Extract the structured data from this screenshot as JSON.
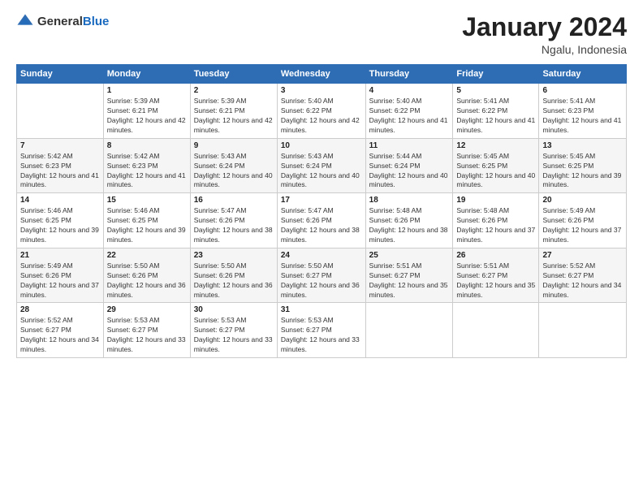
{
  "logo": {
    "text_general": "General",
    "text_blue": "Blue"
  },
  "header": {
    "month": "January 2024",
    "location": "Ngalu, Indonesia"
  },
  "weekdays": [
    "Sunday",
    "Monday",
    "Tuesday",
    "Wednesday",
    "Thursday",
    "Friday",
    "Saturday"
  ],
  "weeks": [
    [
      {
        "day": "",
        "sunrise": "",
        "sunset": "",
        "daylight": ""
      },
      {
        "day": "1",
        "sunrise": "Sunrise: 5:39 AM",
        "sunset": "Sunset: 6:21 PM",
        "daylight": "Daylight: 12 hours and 42 minutes."
      },
      {
        "day": "2",
        "sunrise": "Sunrise: 5:39 AM",
        "sunset": "Sunset: 6:21 PM",
        "daylight": "Daylight: 12 hours and 42 minutes."
      },
      {
        "day": "3",
        "sunrise": "Sunrise: 5:40 AM",
        "sunset": "Sunset: 6:22 PM",
        "daylight": "Daylight: 12 hours and 42 minutes."
      },
      {
        "day": "4",
        "sunrise": "Sunrise: 5:40 AM",
        "sunset": "Sunset: 6:22 PM",
        "daylight": "Daylight: 12 hours and 41 minutes."
      },
      {
        "day": "5",
        "sunrise": "Sunrise: 5:41 AM",
        "sunset": "Sunset: 6:22 PM",
        "daylight": "Daylight: 12 hours and 41 minutes."
      },
      {
        "day": "6",
        "sunrise": "Sunrise: 5:41 AM",
        "sunset": "Sunset: 6:23 PM",
        "daylight": "Daylight: 12 hours and 41 minutes."
      }
    ],
    [
      {
        "day": "7",
        "sunrise": "Sunrise: 5:42 AM",
        "sunset": "Sunset: 6:23 PM",
        "daylight": "Daylight: 12 hours and 41 minutes."
      },
      {
        "day": "8",
        "sunrise": "Sunrise: 5:42 AM",
        "sunset": "Sunset: 6:23 PM",
        "daylight": "Daylight: 12 hours and 41 minutes."
      },
      {
        "day": "9",
        "sunrise": "Sunrise: 5:43 AM",
        "sunset": "Sunset: 6:24 PM",
        "daylight": "Daylight: 12 hours and 40 minutes."
      },
      {
        "day": "10",
        "sunrise": "Sunrise: 5:43 AM",
        "sunset": "Sunset: 6:24 PM",
        "daylight": "Daylight: 12 hours and 40 minutes."
      },
      {
        "day": "11",
        "sunrise": "Sunrise: 5:44 AM",
        "sunset": "Sunset: 6:24 PM",
        "daylight": "Daylight: 12 hours and 40 minutes."
      },
      {
        "day": "12",
        "sunrise": "Sunrise: 5:45 AM",
        "sunset": "Sunset: 6:25 PM",
        "daylight": "Daylight: 12 hours and 40 minutes."
      },
      {
        "day": "13",
        "sunrise": "Sunrise: 5:45 AM",
        "sunset": "Sunset: 6:25 PM",
        "daylight": "Daylight: 12 hours and 39 minutes."
      }
    ],
    [
      {
        "day": "14",
        "sunrise": "Sunrise: 5:46 AM",
        "sunset": "Sunset: 6:25 PM",
        "daylight": "Daylight: 12 hours and 39 minutes."
      },
      {
        "day": "15",
        "sunrise": "Sunrise: 5:46 AM",
        "sunset": "Sunset: 6:25 PM",
        "daylight": "Daylight: 12 hours and 39 minutes."
      },
      {
        "day": "16",
        "sunrise": "Sunrise: 5:47 AM",
        "sunset": "Sunset: 6:26 PM",
        "daylight": "Daylight: 12 hours and 38 minutes."
      },
      {
        "day": "17",
        "sunrise": "Sunrise: 5:47 AM",
        "sunset": "Sunset: 6:26 PM",
        "daylight": "Daylight: 12 hours and 38 minutes."
      },
      {
        "day": "18",
        "sunrise": "Sunrise: 5:48 AM",
        "sunset": "Sunset: 6:26 PM",
        "daylight": "Daylight: 12 hours and 38 minutes."
      },
      {
        "day": "19",
        "sunrise": "Sunrise: 5:48 AM",
        "sunset": "Sunset: 6:26 PM",
        "daylight": "Daylight: 12 hours and 37 minutes."
      },
      {
        "day": "20",
        "sunrise": "Sunrise: 5:49 AM",
        "sunset": "Sunset: 6:26 PM",
        "daylight": "Daylight: 12 hours and 37 minutes."
      }
    ],
    [
      {
        "day": "21",
        "sunrise": "Sunrise: 5:49 AM",
        "sunset": "Sunset: 6:26 PM",
        "daylight": "Daylight: 12 hours and 37 minutes."
      },
      {
        "day": "22",
        "sunrise": "Sunrise: 5:50 AM",
        "sunset": "Sunset: 6:26 PM",
        "daylight": "Daylight: 12 hours and 36 minutes."
      },
      {
        "day": "23",
        "sunrise": "Sunrise: 5:50 AM",
        "sunset": "Sunset: 6:26 PM",
        "daylight": "Daylight: 12 hours and 36 minutes."
      },
      {
        "day": "24",
        "sunrise": "Sunrise: 5:50 AM",
        "sunset": "Sunset: 6:27 PM",
        "daylight": "Daylight: 12 hours and 36 minutes."
      },
      {
        "day": "25",
        "sunrise": "Sunrise: 5:51 AM",
        "sunset": "Sunset: 6:27 PM",
        "daylight": "Daylight: 12 hours and 35 minutes."
      },
      {
        "day": "26",
        "sunrise": "Sunrise: 5:51 AM",
        "sunset": "Sunset: 6:27 PM",
        "daylight": "Daylight: 12 hours and 35 minutes."
      },
      {
        "day": "27",
        "sunrise": "Sunrise: 5:52 AM",
        "sunset": "Sunset: 6:27 PM",
        "daylight": "Daylight: 12 hours and 34 minutes."
      }
    ],
    [
      {
        "day": "28",
        "sunrise": "Sunrise: 5:52 AM",
        "sunset": "Sunset: 6:27 PM",
        "daylight": "Daylight: 12 hours and 34 minutes."
      },
      {
        "day": "29",
        "sunrise": "Sunrise: 5:53 AM",
        "sunset": "Sunset: 6:27 PM",
        "daylight": "Daylight: 12 hours and 33 minutes."
      },
      {
        "day": "30",
        "sunrise": "Sunrise: 5:53 AM",
        "sunset": "Sunset: 6:27 PM",
        "daylight": "Daylight: 12 hours and 33 minutes."
      },
      {
        "day": "31",
        "sunrise": "Sunrise: 5:53 AM",
        "sunset": "Sunset: 6:27 PM",
        "daylight": "Daylight: 12 hours and 33 minutes."
      },
      {
        "day": "",
        "sunrise": "",
        "sunset": "",
        "daylight": ""
      },
      {
        "day": "",
        "sunrise": "",
        "sunset": "",
        "daylight": ""
      },
      {
        "day": "",
        "sunrise": "",
        "sunset": "",
        "daylight": ""
      }
    ]
  ]
}
